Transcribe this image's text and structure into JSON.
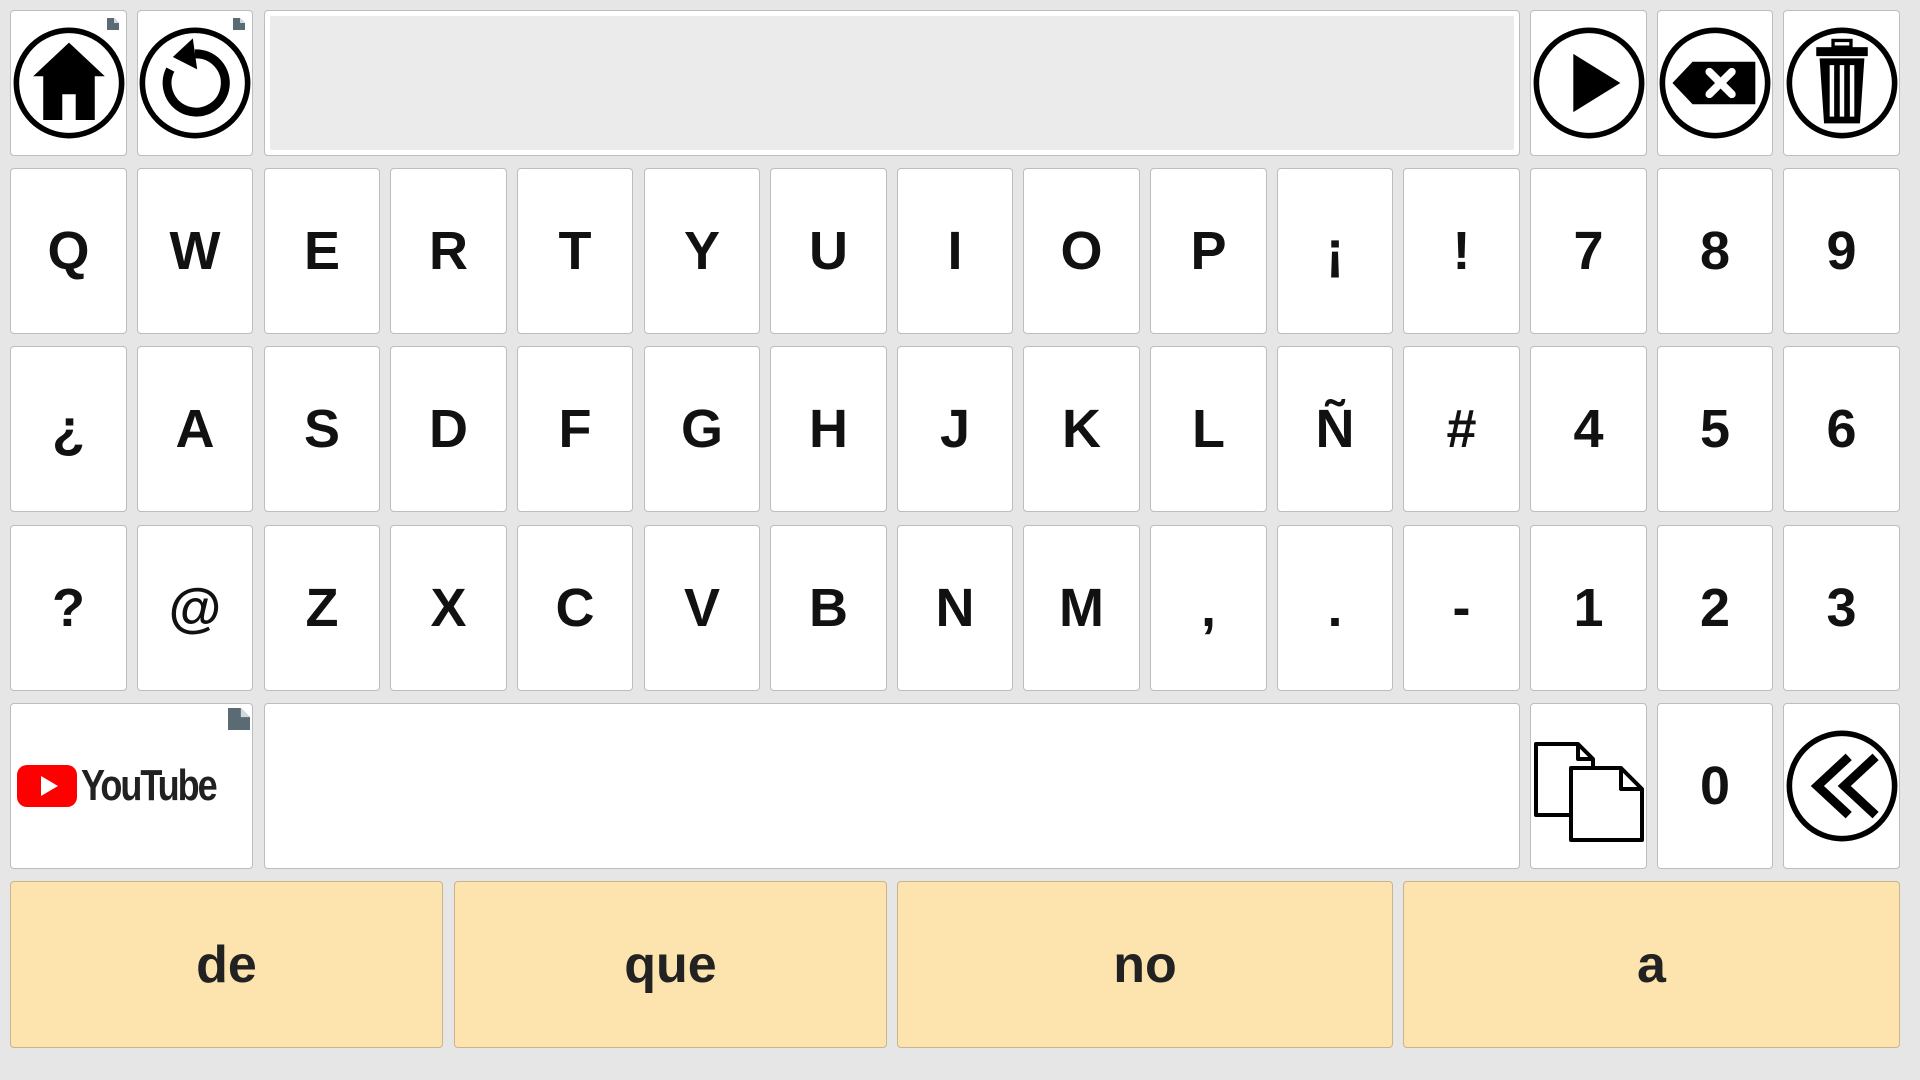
{
  "top_bar": {
    "display_text": "",
    "buttons": [
      {
        "name": "home-button",
        "icon": "home-icon"
      },
      {
        "name": "refresh-button",
        "icon": "refresh-icon"
      },
      {
        "name": "play-button",
        "icon": "play-icon"
      },
      {
        "name": "backspace-button",
        "icon": "backspace-icon"
      },
      {
        "name": "trash-button",
        "icon": "trash-icon"
      }
    ]
  },
  "keyboard": {
    "row1": [
      "Q",
      "W",
      "E",
      "R",
      "T",
      "Y",
      "U",
      "I",
      "O",
      "P",
      "¡",
      "!",
      "7",
      "8",
      "9"
    ],
    "row2": [
      "¿",
      "A",
      "S",
      "D",
      "F",
      "G",
      "H",
      "J",
      "K",
      "L",
      "Ñ",
      "#",
      "4",
      "5",
      "6"
    ],
    "row3": [
      "?",
      "@",
      "Z",
      "X",
      "C",
      "V",
      "B",
      "N",
      "M",
      ",",
      ".",
      "-",
      "1",
      "2",
      "3"
    ],
    "row4": {
      "youtube_label": "YouTube",
      "space_label": "",
      "copy_icon": "copy-icon",
      "zero_label": "0",
      "back_icon": "double-chevron-left-icon"
    }
  },
  "predictions": [
    "de",
    "que",
    "no",
    "a"
  ],
  "colors": {
    "background": "#e6e6e6",
    "key_background": "#ffffff",
    "prediction_background": "#fde3ad",
    "youtube_red": "#ff0000"
  }
}
